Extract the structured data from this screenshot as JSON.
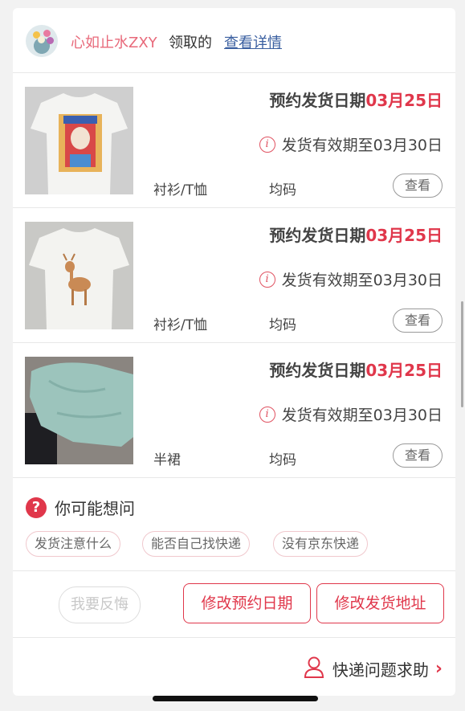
{
  "header": {
    "user_name": "心如止水ZXY",
    "claim_text": "领取的",
    "detail_link": "查看详情"
  },
  "items": [
    {
      "ship_label": "预约发货日期",
      "ship_date": "03月25日",
      "validity": "发货有效期至03月30日",
      "category": "衬衫/T恤",
      "size": "均码",
      "view_label": "查看"
    },
    {
      "ship_label": "预约发货日期",
      "ship_date": "03月25日",
      "validity": "发货有效期至03月30日",
      "category": "衬衫/T恤",
      "size": "均码",
      "view_label": "查看"
    },
    {
      "ship_label": "预约发货日期",
      "ship_date": "03月25日",
      "validity": "发货有效期至03月30日",
      "category": "半裙",
      "size": "均码",
      "view_label": "查看"
    }
  ],
  "faq": {
    "title": "你可能想问",
    "icon_symbol": "?",
    "chips": [
      "发货注意什么",
      "能否自己找快递",
      "没有京东快递"
    ]
  },
  "actions": {
    "regret": "我要反悔",
    "change_date": "修改预约日期",
    "change_address": "修改发货地址"
  },
  "help": {
    "label": "快递问题求助",
    "chevron": "›"
  },
  "icons": {
    "info": "i",
    "question": "question-icon",
    "person": "person-icon"
  },
  "colors": {
    "accent": "#e0374b",
    "username": "#e8697a",
    "link": "#3a5fa0"
  }
}
